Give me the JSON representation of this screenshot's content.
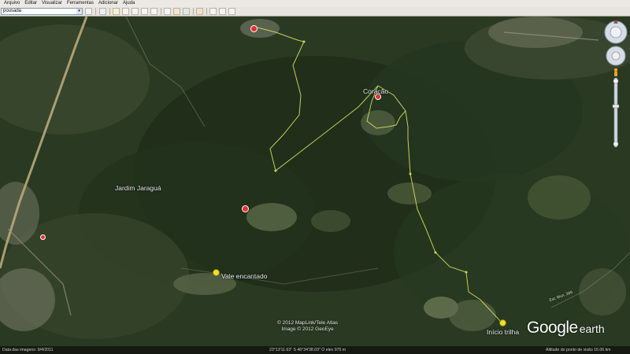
{
  "menu": {
    "items": [
      "Arquivo",
      "Editar",
      "Visualizar",
      "Ferramentas",
      "Adicionar",
      "Ajuda"
    ]
  },
  "toolbar": {
    "search_value": "pousada"
  },
  "map": {
    "places": {
      "jardim_jaragua": "Jardim Jaraguá",
      "coracao": "Coração",
      "vale_encantado": "Vale encantado",
      "inicio_trilha": "Início trilha",
      "road_label": "Est. Mun. 289"
    },
    "copyright_line1": "© 2012 MapLink/Tele Atlas",
    "copyright_line2": "Image © 2012 GeoEye",
    "logo_google": "Google",
    "logo_earth": "earth",
    "colors": {
      "trail": "#cdd85a",
      "pin": "#f0e028",
      "placemark": "#e53030",
      "menubar": "#ece9e4"
    }
  },
  "status": {
    "image_date": "Data das imagens: 9/4/2011",
    "coords": "23°13'11.63\" S  46°34'38.03\" O  elev  975 m",
    "eye_alt": "Altitude do ponto de visão   16.06 km"
  }
}
